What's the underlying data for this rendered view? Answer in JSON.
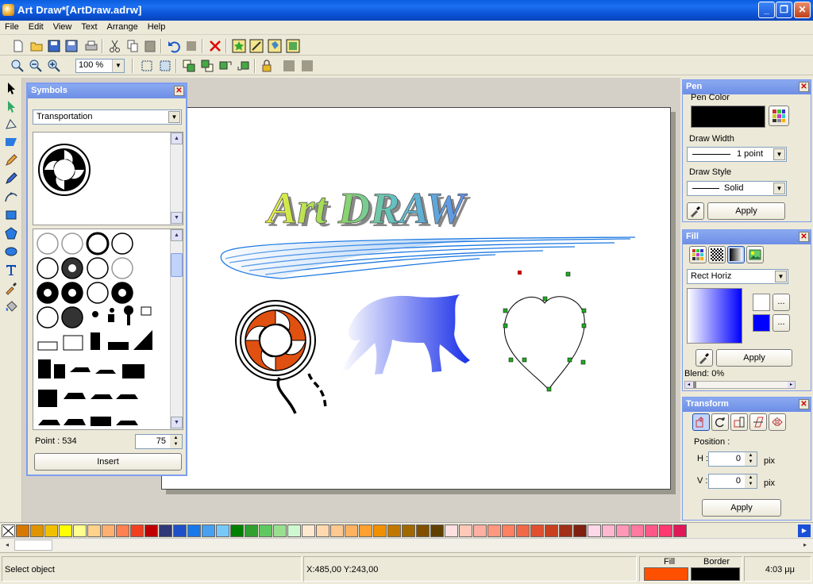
{
  "window": {
    "title": "Art Draw*[ArtDraw.adrw]",
    "minimize": "_",
    "restore": "❐",
    "close": "✕"
  },
  "menu": [
    "File",
    "Edit",
    "View",
    "Text",
    "Arrange",
    "Help"
  ],
  "zoom": {
    "value": "100 %"
  },
  "symbols": {
    "title": "Symbols",
    "category": "Transportation",
    "point_label": "Point : 534",
    "point_value": "75",
    "insert": "Insert"
  },
  "pen": {
    "title": "Pen",
    "color_label": "Pen Color",
    "color": "#000000",
    "width_label": "Draw Width",
    "width_value": "1 point",
    "style_label": "Draw Style",
    "style_value": "Solid",
    "apply": "Apply"
  },
  "fill": {
    "title": "Fill",
    "type": "Rect Horiz",
    "color1": "#ffffff",
    "color2": "#0000ff",
    "more": "...",
    "apply": "Apply",
    "blend": "Blend: 0%"
  },
  "transform": {
    "title": "Transform",
    "position_label": "Position :",
    "h_label": "H :",
    "h_value": "0",
    "v_label": "V :",
    "v_value": "0",
    "unit": "pix",
    "apply": "Apply"
  },
  "canvas": {
    "text": "Art DRAW"
  },
  "palette": [
    "#d77800",
    "#e09400",
    "#f0c000",
    "#ffff00",
    "#ffff90",
    "#ffd28c",
    "#ffb070",
    "#ff8050",
    "#f04020",
    "#c00000",
    "#303878",
    "#2050c8",
    "#1878e8",
    "#48a0f0",
    "#78c8f8",
    "#008000",
    "#30a030",
    "#60c860",
    "#98e090",
    "#d0f8d0",
    "#ffe8d0",
    "#ffd8b0",
    "#ffc890",
    "#ffb060",
    "#ffa030",
    "#f09000",
    "#c07800",
    "#a06800",
    "#805000",
    "#604000",
    "#ffe0e0",
    "#ffc8b8",
    "#ffb0a0",
    "#ff9880",
    "#ff8060",
    "#f06848",
    "#e05030",
    "#c84020",
    "#a03018",
    "#802010",
    "#ffd8e8",
    "#ffb8d0",
    "#ff98b8",
    "#ff78a0",
    "#ff5888",
    "#ff3870",
    "#e01858"
  ],
  "status": {
    "message": "Select object",
    "coords": "X:485,00 Y:243,00",
    "fill_label": "Fill",
    "border_label": "Border",
    "fill_color": "#ff5000",
    "border_color": "#000000",
    "time": "4:03 μμ"
  }
}
